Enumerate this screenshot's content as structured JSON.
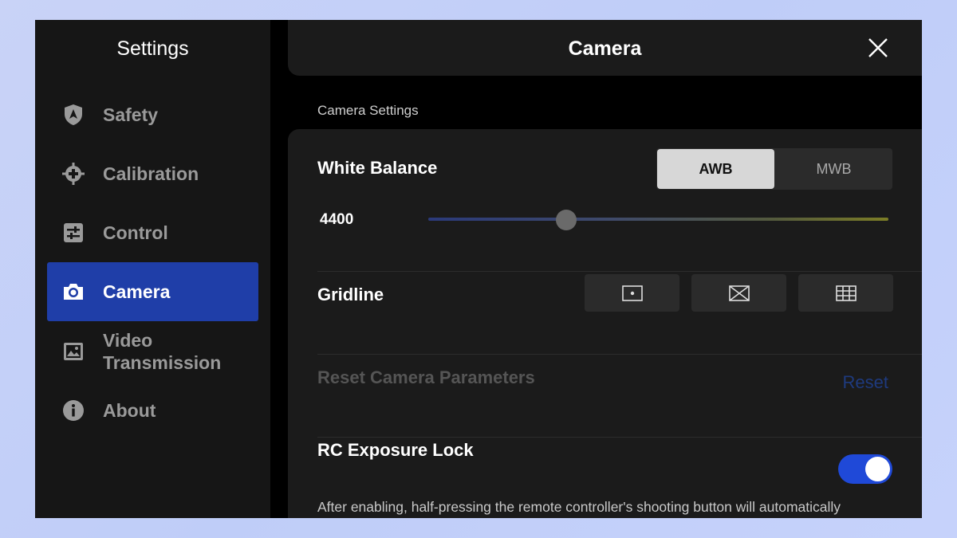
{
  "sidebar": {
    "title": "Settings",
    "items": [
      {
        "label": "Safety",
        "icon": "shield-icon"
      },
      {
        "label": "Calibration",
        "icon": "crosshair-icon"
      },
      {
        "label": "Control",
        "icon": "sliders-icon"
      },
      {
        "label": "Camera",
        "icon": "camera-icon",
        "active": true
      },
      {
        "label": "Video Transmission",
        "icon": "image-icon"
      },
      {
        "label": "About",
        "icon": "info-icon"
      }
    ]
  },
  "header": {
    "title": "Camera",
    "close_icon": "close-icon"
  },
  "main": {
    "section_label": "Camera Settings",
    "white_balance": {
      "title": "White Balance",
      "options": [
        "AWB",
        "MWB"
      ],
      "selected": "AWB",
      "value": "4400",
      "slider_fraction": 0.3
    },
    "gridline": {
      "title": "Gridline",
      "options": [
        "center-dot-grid-icon",
        "diagonal-grid-icon",
        "nine-grid-icon"
      ]
    },
    "reset": {
      "title": "Reset Camera Parameters",
      "link": "Reset"
    },
    "exposure_lock": {
      "title": "RC Exposure Lock",
      "enabled": true,
      "description": "After enabling, half-pressing the remote controller's shooting button will automatically lock the exposure until the button is released."
    }
  },
  "colors": {
    "accent": "#1f49d8",
    "active_nav": "#1f3ea8",
    "reset_link": "#1e3a7e"
  }
}
